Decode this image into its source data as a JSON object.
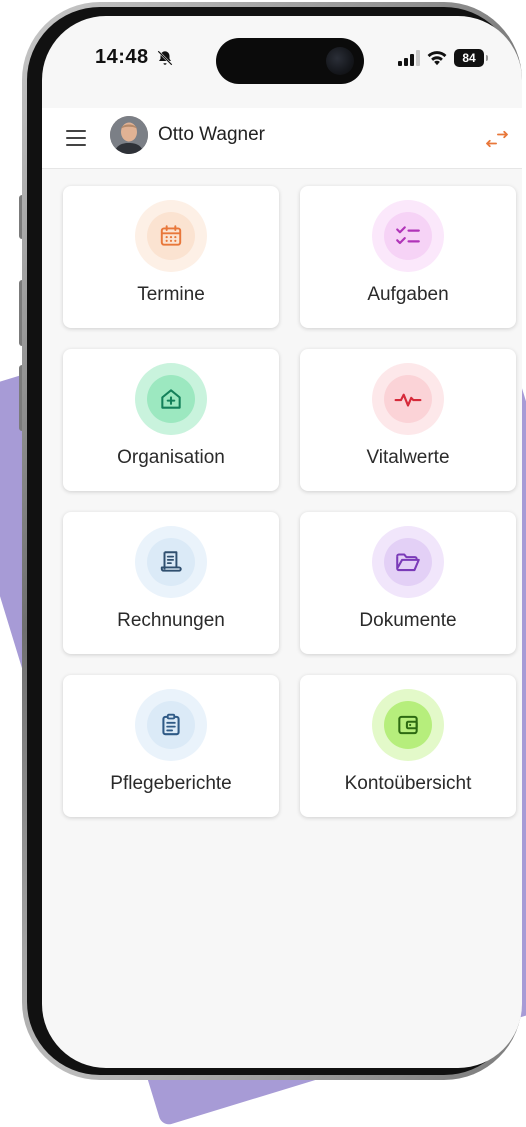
{
  "status_bar": {
    "time": "14:48",
    "battery": "84"
  },
  "header": {
    "user_name": "Otto Wagner"
  },
  "tiles": [
    {
      "label": "Termine",
      "icon": "calendar-icon",
      "color": "#e8773a",
      "bg_outer": "#fdf0e6",
      "bg_inner": "#fbe3d1"
    },
    {
      "label": "Aufgaben",
      "icon": "checklist-icon",
      "color": "#b034b8",
      "bg_outer": "#fbe8fb",
      "bg_inner": "#f6d3f6"
    },
    {
      "label": "Organisation",
      "icon": "house-medical-icon",
      "color": "#14805a",
      "bg_outer": "#c9f3dd",
      "bg_inner": "#9ce8c0"
    },
    {
      "label": "Vitalwerte",
      "icon": "heartbeat-icon",
      "color": "#d62a3a",
      "bg_outer": "#fde8ea",
      "bg_inner": "#fbd3d7"
    },
    {
      "label": "Rechnungen",
      "icon": "receipt-icon",
      "color": "#2f4f6f",
      "bg_outer": "#eaf3fb",
      "bg_inner": "#dbeaf7"
    },
    {
      "label": "Dokumente",
      "icon": "folder-icon",
      "color": "#7a3ab8",
      "bg_outer": "#f1e6fb",
      "bg_inner": "#e3d0f6"
    },
    {
      "label": "Pflegeberichte",
      "icon": "clipboard-icon",
      "color": "#2f5a86",
      "bg_outer": "#eaf3fb",
      "bg_inner": "#dbeaf7"
    },
    {
      "label": "Kontoübersicht",
      "icon": "wallet-icon",
      "color": "#2d6a12",
      "bg_outer": "#e3f9c9",
      "bg_inner": "#b6ee7c"
    }
  ],
  "colors": {
    "accent_orange": "#e8773a",
    "backdrop_purple": "#a79bd6"
  }
}
